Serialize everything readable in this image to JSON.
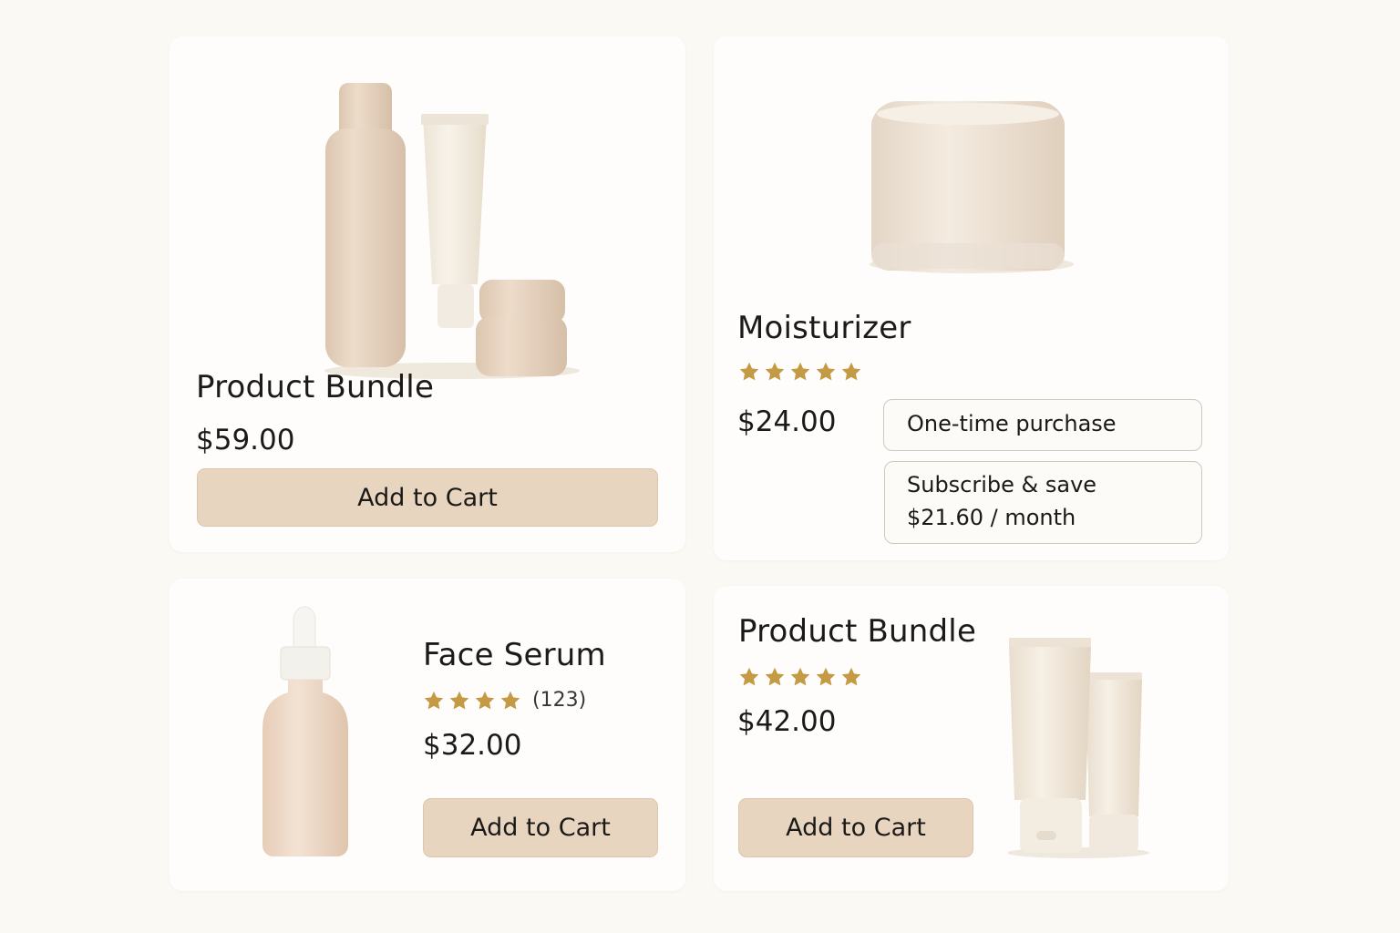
{
  "colors": {
    "page_background": "#fbf9f4",
    "card_background": "#fefdfb",
    "button_background": "#e8d5c0",
    "star_color": "#c49a45",
    "product_beige": "#ecdcca",
    "product_cream": "#f3ebdf"
  },
  "products": [
    {
      "title": "Product Bundle",
      "price": "$59.00",
      "cta_label": "Add to Cart",
      "image_icon": "bundle-bottle-tube-jar-image"
    },
    {
      "title": "Moisturizer",
      "rating": 5,
      "price": "$24.00",
      "image_icon": "cream-jar-image",
      "purchase_options": {
        "one_time_label": "One-time purchase",
        "subscribe_label": "Subscribe & save",
        "subscribe_price": "$21.60 / month"
      }
    },
    {
      "title": "Face Serum",
      "rating": 4,
      "review_count": "(123)",
      "price": "$32.00",
      "cta_label": "Add to Cart",
      "image_icon": "dropper-bottle-image"
    },
    {
      "title": "Product Bundle",
      "rating": 5,
      "price": "$42.00",
      "cta_label": "Add to Cart",
      "image_icon": "two-tubes-image"
    }
  ]
}
